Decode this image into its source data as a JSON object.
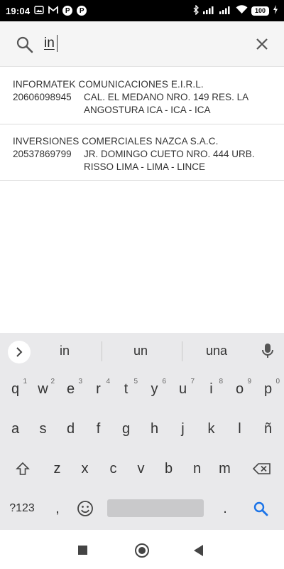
{
  "status_bar": {
    "time": "19:04",
    "left_icons": [
      "photo-icon",
      "gmail-icon",
      "p-app-icon",
      "p-app-icon"
    ],
    "battery": "100"
  },
  "search": {
    "value": "in",
    "clear_icon": "close-icon"
  },
  "results": [
    {
      "name": "INFORMATEK COMUNICACIONES E.I.R.L.",
      "ruc": "20606098945",
      "address_line1": "CAL. EL MEDANO NRO. 149 RES. LA",
      "address_line2": "ANGOSTURA ICA - ICA - ICA"
    },
    {
      "name": "INVERSIONES COMERCIALES NAZCA S.A.C.",
      "ruc": "20537869799",
      "address_line1": "JR. DOMINGO CUETO NRO. 444 URB.",
      "address_line2": "RISSO LIMA - LIMA - LINCE"
    }
  ],
  "keyboard": {
    "suggestions": [
      "in",
      "un",
      "una"
    ],
    "row1": [
      {
        "k": "q",
        "h": "1"
      },
      {
        "k": "w",
        "h": "2"
      },
      {
        "k": "e",
        "h": "3"
      },
      {
        "k": "r",
        "h": "4"
      },
      {
        "k": "t",
        "h": "5"
      },
      {
        "k": "y",
        "h": "6"
      },
      {
        "k": "u",
        "h": "7"
      },
      {
        "k": "i",
        "h": "8"
      },
      {
        "k": "o",
        "h": "9"
      },
      {
        "k": "p",
        "h": "0"
      }
    ],
    "row2": [
      "a",
      "s",
      "d",
      "f",
      "g",
      "h",
      "j",
      "k",
      "l",
      "ñ"
    ],
    "row3": [
      "z",
      "x",
      "c",
      "v",
      "b",
      "n",
      "m"
    ],
    "symbols_label": "?123",
    "comma": ",",
    "period": "."
  },
  "colors": {
    "accent": "#1a73e8",
    "keyboard_bg": "#e9e9eb"
  }
}
